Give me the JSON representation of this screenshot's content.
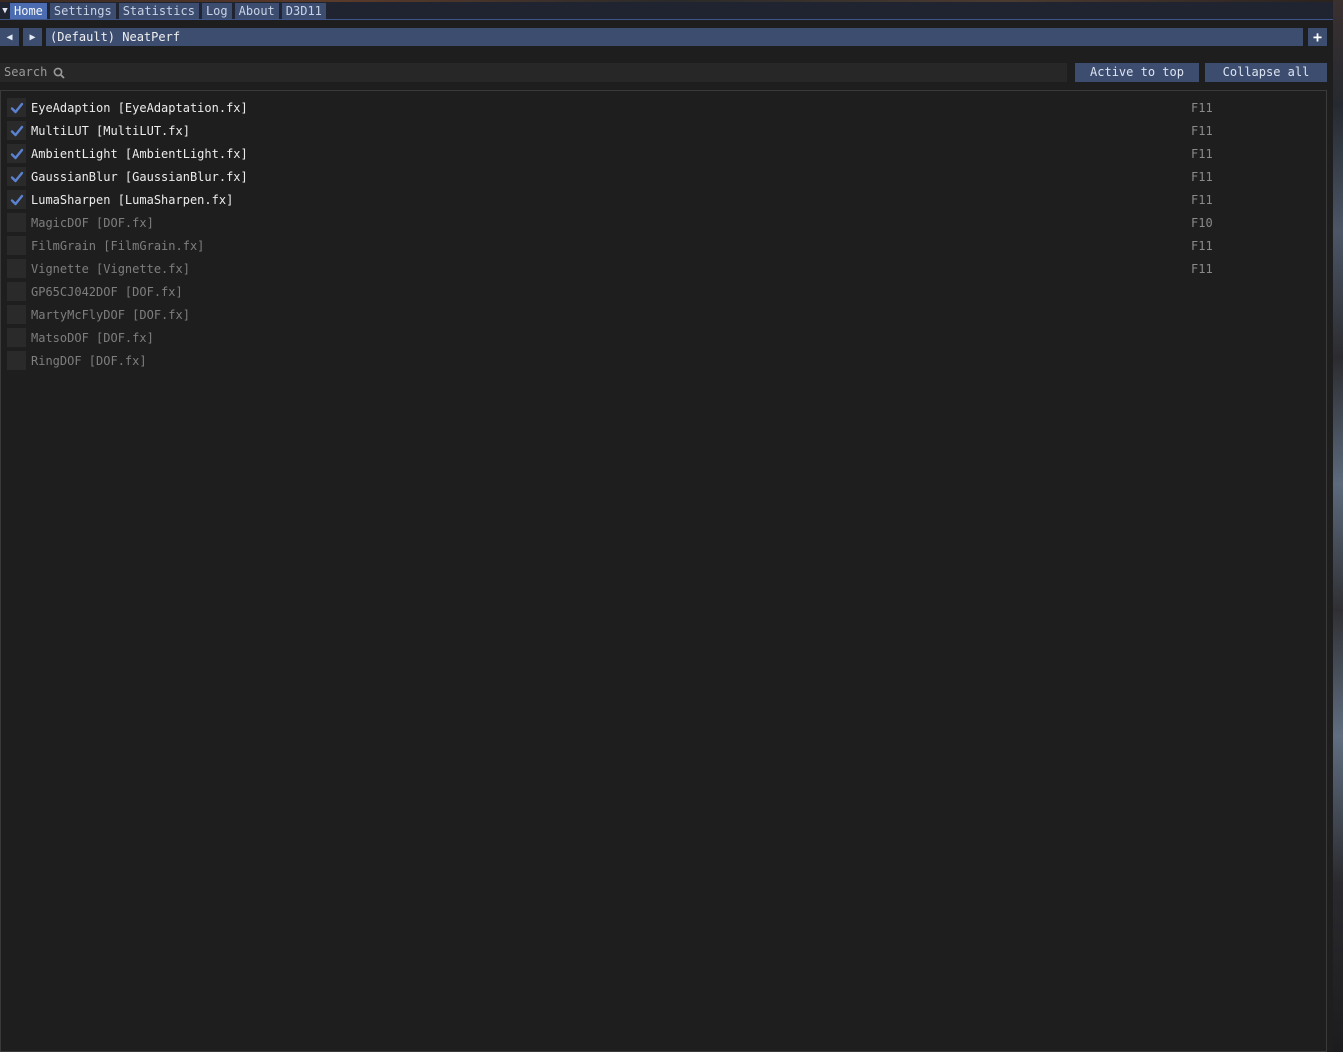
{
  "menu": {
    "tabs": [
      {
        "label": "Home",
        "active": true
      },
      {
        "label": "Settings",
        "active": false
      },
      {
        "label": "Statistics",
        "active": false
      },
      {
        "label": "Log",
        "active": false
      },
      {
        "label": "About",
        "active": false
      },
      {
        "label": "D3D11",
        "active": false
      }
    ]
  },
  "preset": {
    "name": "(Default) NeatPerf"
  },
  "search": {
    "placeholder": "Search"
  },
  "buttons": {
    "active_to_top": "Active to top",
    "collapse_all": "Collapse all"
  },
  "effects": [
    {
      "label": "EyeAdaption [EyeAdaptation.fx]",
      "enabled": true,
      "key": "F11"
    },
    {
      "label": "MultiLUT [MultiLUT.fx]",
      "enabled": true,
      "key": "F11"
    },
    {
      "label": "AmbientLight [AmbientLight.fx]",
      "enabled": true,
      "key": "F11"
    },
    {
      "label": "GaussianBlur [GaussianBlur.fx]",
      "enabled": true,
      "key": "F11"
    },
    {
      "label": "LumaSharpen [LumaSharpen.fx]",
      "enabled": true,
      "key": "F11"
    },
    {
      "label": "MagicDOF [DOF.fx]",
      "enabled": false,
      "key": "F10"
    },
    {
      "label": "FilmGrain [FilmGrain.fx]",
      "enabled": false,
      "key": "F11"
    },
    {
      "label": "Vignette [Vignette.fx]",
      "enabled": false,
      "key": "F11"
    },
    {
      "label": "GP65CJ042DOF [DOF.fx]",
      "enabled": false,
      "key": ""
    },
    {
      "label": "MartyMcFlyDOF [DOF.fx]",
      "enabled": false,
      "key": ""
    },
    {
      "label": "MatsoDOF [DOF.fx]",
      "enabled": false,
      "key": ""
    },
    {
      "label": "RingDOF [DOF.fx]",
      "enabled": false,
      "key": ""
    }
  ],
  "colors": {
    "accent": "#4b6cb0",
    "button": "#3d4d70",
    "check": "#5a82d0"
  }
}
